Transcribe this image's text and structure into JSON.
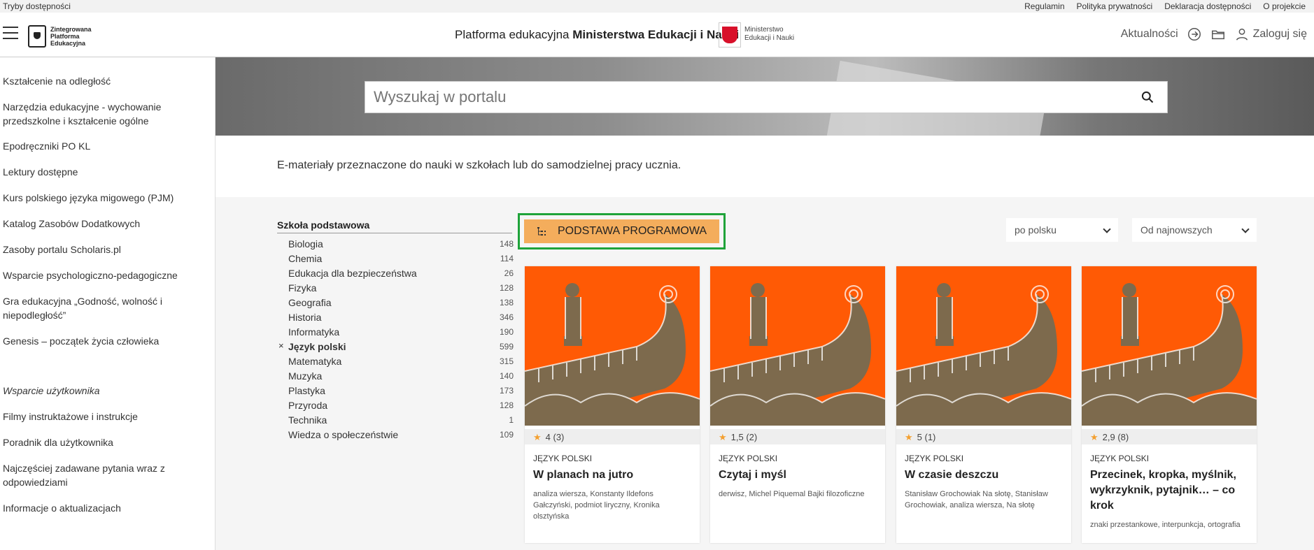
{
  "utility": {
    "accessibility": "Tryby dostępności",
    "links": [
      "Regulamin",
      "Polityka prywatności",
      "Deklaracja dostępności",
      "O projekcie"
    ]
  },
  "header": {
    "logo_text": "Zintegrowana Platforma Edukacyjna",
    "title_prefix": "Platforma edukacyjna ",
    "title_bold": "Ministerstwa Edukacji i Nauki",
    "ministry_line1": "Ministerstwo",
    "ministry_line2": "Edukacji i Nauki",
    "news": "Aktualności",
    "login": "Zaloguj się"
  },
  "sidebar": {
    "items": [
      "Kształcenie na odległość",
      "Narzędzia edukacyjne - wychowanie przedszkolne i kształcenie ogólne",
      "Epodręczniki PO KL",
      "Lektury dostępne",
      "Kurs polskiego języka migowego (PJM)",
      "Katalog Zasobów Dodatkowych",
      "Zasoby portalu Scholaris.pl",
      "Wsparcie psychologiczno-pedagogiczne",
      "Gra edukacyjna „Godność, wolność i niepodległość”",
      "Genesis – początek życia człowieka"
    ],
    "support_title": "Wsparcie użytkownika",
    "support_items": [
      "Filmy instruktażowe i instrukcje",
      "Poradnik dla użytkownika",
      "Najczęściej zadawane pytania wraz z odpowiedziami",
      "Informacje o aktualizacjach"
    ]
  },
  "search": {
    "placeholder": "Wyszukaj w portalu"
  },
  "intro": "E-materiały przeznaczone do nauki w szkołach lub do samodzielnej pracy ucznia.",
  "filter": {
    "title": "Szkoła podstawowa",
    "items": [
      {
        "label": "Biologia",
        "count": "148"
      },
      {
        "label": "Chemia",
        "count": "114"
      },
      {
        "label": "Edukacja dla bezpieczeństwa",
        "count": "26"
      },
      {
        "label": "Fizyka",
        "count": "128"
      },
      {
        "label": "Geografia",
        "count": "138"
      },
      {
        "label": "Historia",
        "count": "346"
      },
      {
        "label": "Informatyka",
        "count": "190"
      },
      {
        "label": "Język polski",
        "count": "599",
        "active": "×"
      },
      {
        "label": "Matematyka",
        "count": "315"
      },
      {
        "label": "Muzyka",
        "count": "140"
      },
      {
        "label": "Plastyka",
        "count": "173"
      },
      {
        "label": "Przyroda",
        "count": "128"
      },
      {
        "label": "Technika",
        "count": "1"
      },
      {
        "label": "Wiedza o społeczeństwie",
        "count": "109"
      }
    ]
  },
  "toolbar": {
    "podstawa": "PODSTAWA PROGRAMOWA",
    "language": "po polsku",
    "sort": "Od najnowszych"
  },
  "colors": {
    "accent_orange": "#f4ad5c",
    "highlight_green": "#1fa33a",
    "thumb_orange": "#ff5a05"
  },
  "cards": [
    {
      "rating": "4 (3)",
      "subject": "JĘZYK POLSKI",
      "title": "W planach na jutro",
      "tags": "analiza wiersza,  Konstanty Ildefons Gałczyński,  podmiot liryczny,  Kronika olsztyńska"
    },
    {
      "rating": "1,5 (2)",
      "subject": "JĘZYK POLSKI",
      "title": "Czytaj i myśl",
      "tags": "derwisz,  Michel Piquemal Bajki filozoficzne"
    },
    {
      "rating": "5 (1)",
      "subject": "JĘZYK POLSKI",
      "title": "W czasie deszczu",
      "tags": "Stanisław Grochowiak Na słotę,  Stanisław Grochowiak,  analiza wiersza,  Na słotę"
    },
    {
      "rating": "2,9 (8)",
      "subject": "JĘZYK POLSKI",
      "title": "Przecinek, kropka, myślnik, wykrzyknik, pytajnik… – co krok",
      "tags": "znaki przestankowe,  interpunkcja,  ortografia"
    }
  ]
}
